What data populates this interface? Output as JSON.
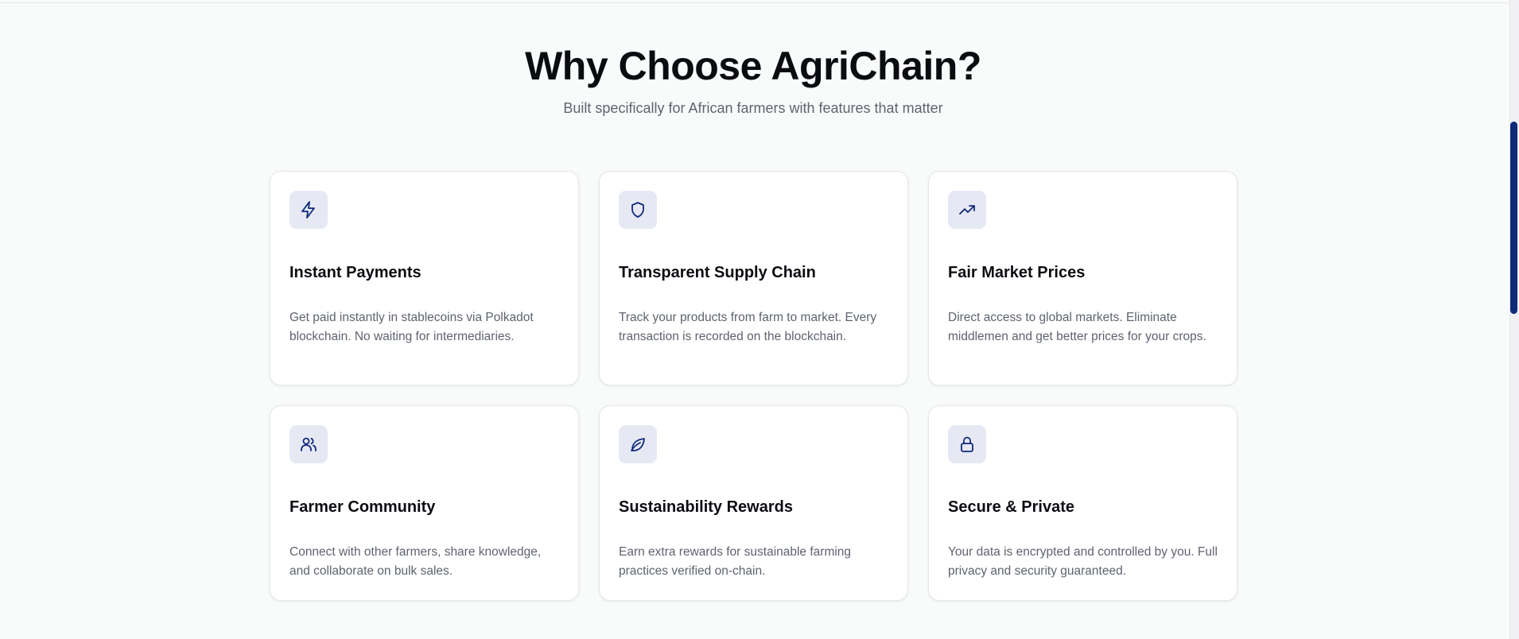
{
  "section": {
    "title": "Why Choose AgriChain?",
    "subtitle": "Built specifically for African farmers with features that matter"
  },
  "features": [
    {
      "icon": "lightning-icon",
      "title": "Instant Payments",
      "description": "Get paid instantly in stablecoins via Polkadot blockchain. No waiting for intermediaries."
    },
    {
      "icon": "shield-icon",
      "title": "Transparent Supply Chain",
      "description": "Track your products from farm to market. Every transaction is recorded on the blockchain."
    },
    {
      "icon": "trending-up-icon",
      "title": "Fair Market Prices",
      "description": "Direct access to global markets. Eliminate middlemen and get better prices for your crops."
    },
    {
      "icon": "users-icon",
      "title": "Farmer Community",
      "description": "Connect with other farmers, share knowledge, and collaborate on bulk sales."
    },
    {
      "icon": "leaf-icon",
      "title": "Sustainability Rewards",
      "description": "Earn extra rewards for sustainable farming practices verified on-chain."
    },
    {
      "icon": "lock-icon",
      "title": "Secure & Private",
      "description": "Your data is encrypted and controlled by you. Full privacy and security guaranteed."
    }
  ],
  "colors": {
    "accent": "#102a7a",
    "icon_background": "#e6e8f4",
    "page_background": "#f9fafa",
    "card_background": "#ffffff",
    "muted_text": "#5e636e"
  }
}
